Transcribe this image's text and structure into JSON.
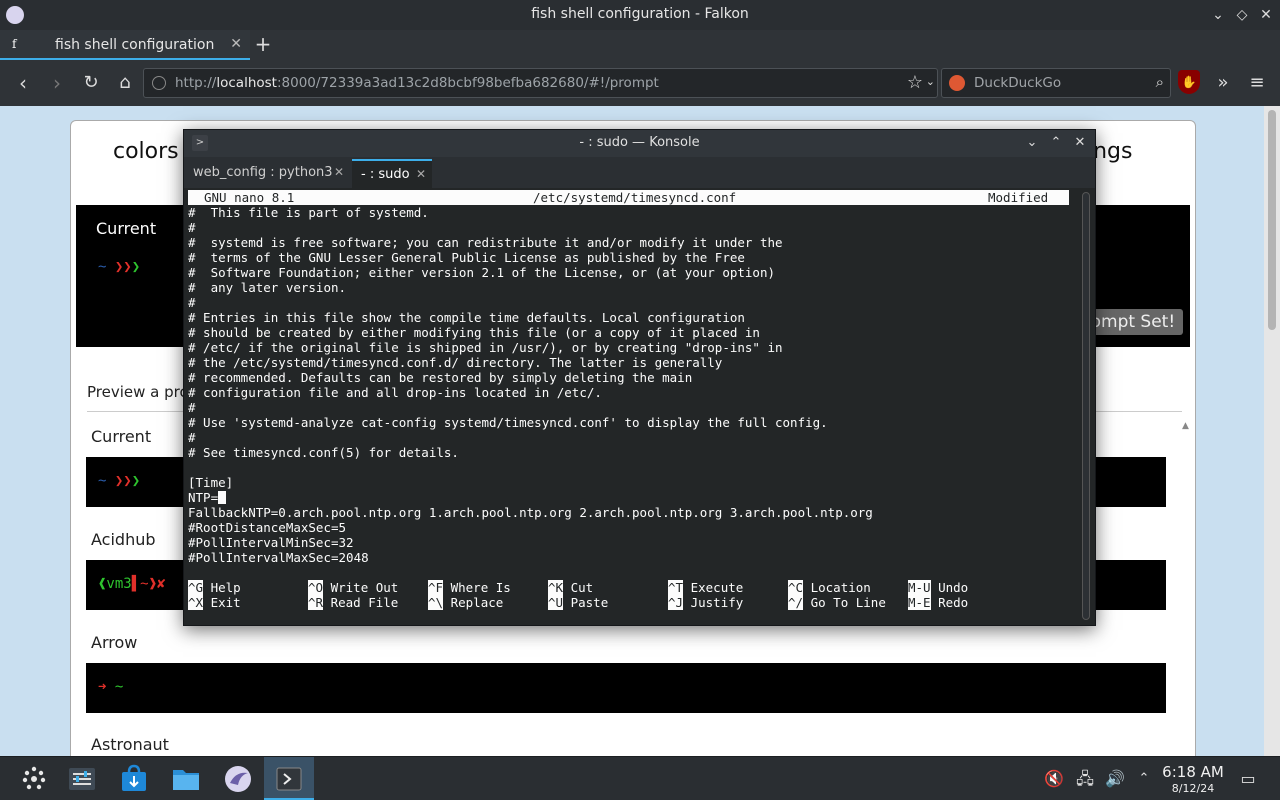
{
  "browser": {
    "window_title": "fish shell configuration - Falkon",
    "tab_label": "fish shell configuration",
    "tab_favicon": "f",
    "url_prefix": "http://",
    "url_host": "localhost",
    "url_rest": ":8000/72339a3ad13c2d8bcbf98befba682680/#!/prompt",
    "search_placeholder": "DuckDuckGo"
  },
  "page": {
    "nav_colors": "colors",
    "nav_bindings": "ings",
    "current_label": "Current",
    "prompt_set": "rompt Set!",
    "preview_label": "Preview a pro",
    "items": [
      {
        "label": "Current"
      },
      {
        "label": "Acidhub"
      },
      {
        "label": "Arrow"
      },
      {
        "label": "Astronaut"
      }
    ],
    "prompt_current": "~ ❯❯❯",
    "prompt_acidhub": "❰vm3▌~❱✘",
    "prompt_arrow_glyph": "➜",
    "prompt_arrow_tilde": "~"
  },
  "konsole": {
    "title": "- : sudo — Konsole",
    "tabs": [
      {
        "label": "web_config : python3"
      },
      {
        "label": "- : sudo"
      }
    ],
    "nano_version": "GNU nano 8.1",
    "file_path": "/etc/systemd/timesyncd.conf",
    "status": "Modified",
    "lines": [
      "#  This file is part of systemd.",
      "#",
      "#  systemd is free software; you can redistribute it and/or modify it under the",
      "#  terms of the GNU Lesser General Public License as published by the Free",
      "#  Software Foundation; either version 2.1 of the License, or (at your option)",
      "#  any later version.",
      "#",
      "# Entries in this file show the compile time defaults. Local configuration",
      "# should be created by either modifying this file (or a copy of it placed in",
      "# /etc/ if the original file is shipped in /usr/), or by creating \"drop-ins\" in",
      "# the /etc/systemd/timesyncd.conf.d/ directory. The latter is generally",
      "# recommended. Defaults can be restored by simply deleting the main",
      "# configuration file and all drop-ins located in /etc/.",
      "#",
      "# Use 'systemd-analyze cat-config systemd/timesyncd.conf' to display the full config.",
      "#",
      "# See timesyncd.conf(5) for details.",
      "",
      "[Time]",
      "NTP=",
      "FallbackNTP=0.arch.pool.ntp.org 1.arch.pool.ntp.org 2.arch.pool.ntp.org 3.arch.pool.ntp.org",
      "#RootDistanceMaxSec=5",
      "#PollIntervalMinSec=32",
      "#PollIntervalMaxSec=2048"
    ],
    "shortcuts_row1": [
      {
        "key": "^G",
        "label": "Help"
      },
      {
        "key": "^O",
        "label": "Write Out"
      },
      {
        "key": "^F",
        "label": "Where Is"
      },
      {
        "key": "^K",
        "label": "Cut"
      },
      {
        "key": "^T",
        "label": "Execute"
      },
      {
        "key": "^C",
        "label": "Location"
      },
      {
        "key": "M-U",
        "label": "Undo"
      }
    ],
    "shortcuts_row2": [
      {
        "key": "^X",
        "label": "Exit"
      },
      {
        "key": "^R",
        "label": "Read File"
      },
      {
        "key": "^\\",
        "label": "Replace"
      },
      {
        "key": "^U",
        "label": "Paste"
      },
      {
        "key": "^J",
        "label": "Justify"
      },
      {
        "key": "^/",
        "label": "Go To Line"
      },
      {
        "key": "M-E",
        "label": "Redo"
      }
    ]
  },
  "taskbar": {
    "time": "6:18 AM",
    "date": "8/12/24"
  },
  "colors": {
    "accent": "#3daee9",
    "terminal_bg": "#232627",
    "prompt_blue": "#2a5caa",
    "prompt_red": "#e0302a",
    "prompt_green": "#2ec42e"
  }
}
